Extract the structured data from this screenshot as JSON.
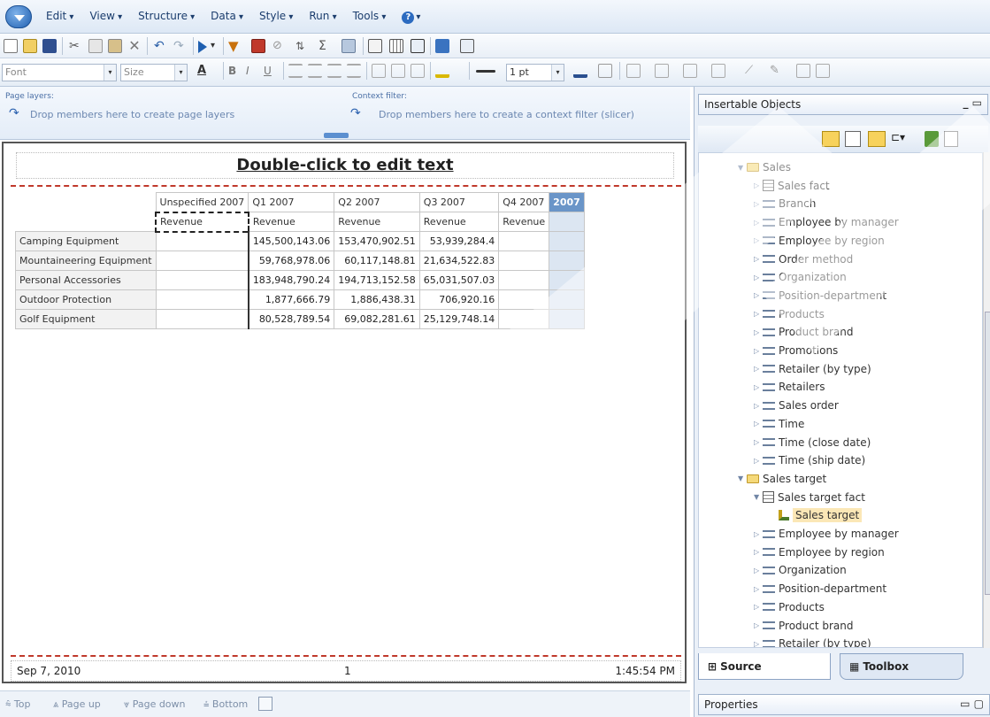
{
  "menu": {
    "items": [
      "Edit",
      "View",
      "Structure",
      "Data",
      "Style",
      "Run",
      "Tools"
    ]
  },
  "format_toolbar": {
    "font_placeholder": "Font",
    "size_placeholder": "Size",
    "line_width": "1 pt"
  },
  "layers": {
    "page_layers_title": "Page layers:",
    "page_layers_hint": "Drop members here to create page layers",
    "context_filter_title": "Context filter:",
    "context_filter_hint": "Drop members here to create a context filter (slicer)"
  },
  "report": {
    "header_text": "Double-click to edit text",
    "columns": [
      "Unspecified 2007",
      "Q1 2007",
      "Q2 2007",
      "Q3 2007",
      "Q4 2007",
      "2007"
    ],
    "measure": "Revenue",
    "rows": [
      {
        "label": "Camping Equipment",
        "values": [
          "",
          "145,500,143.06",
          "153,470,902.51",
          "53,939,284.4",
          "",
          ""
        ]
      },
      {
        "label": "Mountaineering Equipment",
        "values": [
          "",
          "59,768,978.06",
          "60,117,148.81",
          "21,634,522.83",
          "",
          ""
        ]
      },
      {
        "label": "Personal Accessories",
        "values": [
          "",
          "183,948,790.24",
          "194,713,152.58",
          "65,031,507.03",
          "",
          ""
        ]
      },
      {
        "label": "Outdoor Protection",
        "values": [
          "",
          "1,877,666.79",
          "1,886,438.31",
          "706,920.16",
          "",
          ""
        ]
      },
      {
        "label": "Golf Equipment",
        "values": [
          "",
          "80,528,789.54",
          "69,082,281.61",
          "25,129,748.14",
          "",
          ""
        ]
      }
    ],
    "footer": {
      "date": "Sep 7, 2010",
      "page": "1",
      "time": "1:45:54 PM"
    }
  },
  "page_nav": {
    "top": "Top",
    "page_up": "Page up",
    "page_down": "Page down",
    "bottom": "Bottom"
  },
  "insertable": {
    "title": "Insertable Objects",
    "tree": [
      {
        "label": "Sales",
        "kind": "folder",
        "level": 0,
        "expanded": true
      },
      {
        "label": "Sales fact",
        "kind": "fact",
        "level": 1
      },
      {
        "label": "Branch",
        "kind": "dim",
        "level": 1
      },
      {
        "label": "Employee by manager",
        "kind": "dim",
        "level": 1
      },
      {
        "label": "Employee by region",
        "kind": "dim",
        "level": 1
      },
      {
        "label": "Order method",
        "kind": "dim",
        "level": 1
      },
      {
        "label": "Organization",
        "kind": "dim",
        "level": 1
      },
      {
        "label": "Position-department",
        "kind": "dim",
        "level": 1
      },
      {
        "label": "Products",
        "kind": "dim",
        "level": 1
      },
      {
        "label": "Product brand",
        "kind": "dim",
        "level": 1
      },
      {
        "label": "Promotions",
        "kind": "dim",
        "level": 1
      },
      {
        "label": "Retailer (by type)",
        "kind": "dim",
        "level": 1
      },
      {
        "label": "Retailers",
        "kind": "dim",
        "level": 1
      },
      {
        "label": "Sales order",
        "kind": "dim",
        "level": 1
      },
      {
        "label": "Time",
        "kind": "dim",
        "level": 1
      },
      {
        "label": "Time (close date)",
        "kind": "dim",
        "level": 1
      },
      {
        "label": "Time (ship date)",
        "kind": "dim",
        "level": 1
      },
      {
        "label": "Sales target",
        "kind": "folder",
        "level": 0,
        "expanded": true
      },
      {
        "label": "Sales target fact",
        "kind": "fact",
        "level": 1,
        "expanded": true
      },
      {
        "label": "Sales target",
        "kind": "measure",
        "level": 2,
        "selected": true
      },
      {
        "label": "Employee by manager",
        "kind": "dim",
        "level": 1
      },
      {
        "label": "Employee by region",
        "kind": "dim",
        "level": 1
      },
      {
        "label": "Organization",
        "kind": "dim",
        "level": 1
      },
      {
        "label": "Position-department",
        "kind": "dim",
        "level": 1
      },
      {
        "label": "Products",
        "kind": "dim",
        "level": 1
      },
      {
        "label": "Product brand",
        "kind": "dim",
        "level": 1
      },
      {
        "label": "Retailer (by type)",
        "kind": "dim",
        "level": 1
      }
    ],
    "tabs": {
      "source": "Source",
      "toolbox": "Toolbox"
    },
    "properties": "Properties"
  }
}
